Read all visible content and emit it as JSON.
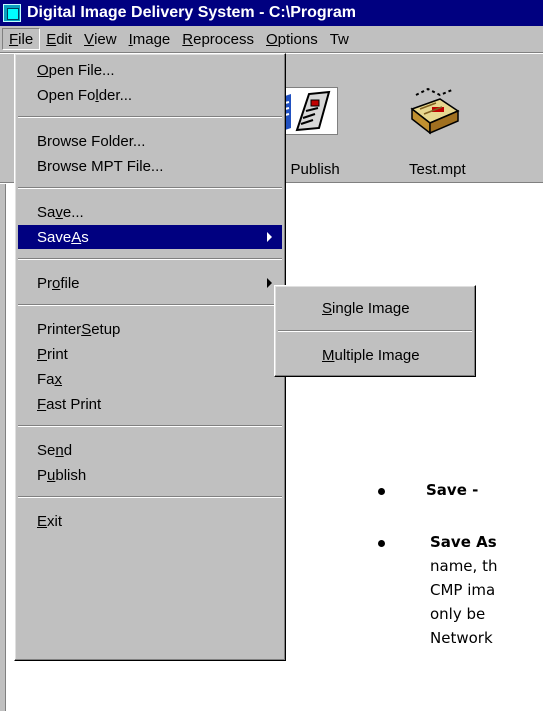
{
  "window": {
    "title": "Digital Image Delivery System - C:\\Program"
  },
  "menubar": {
    "items": [
      {
        "key": "file",
        "pre": "",
        "u": "F",
        "post": "ile"
      },
      {
        "key": "edit",
        "pre": "",
        "u": "E",
        "post": "dit"
      },
      {
        "key": "view",
        "pre": "",
        "u": "V",
        "post": "iew"
      },
      {
        "key": "image",
        "pre": "",
        "u": "I",
        "post": "mage"
      },
      {
        "key": "reprocess",
        "pre": "",
        "u": "R",
        "post": "eprocess"
      },
      {
        "key": "options",
        "pre": "",
        "u": "O",
        "post": "ptions"
      },
      {
        "key": "tw",
        "pre": "Tw",
        "u": "",
        "post": ""
      }
    ]
  },
  "toolbar": {
    "buttons": [
      {
        "label": "d Publish"
      },
      {
        "label": "Test.mpt"
      }
    ]
  },
  "file_menu": {
    "items": [
      {
        "key": "open-file",
        "pre": "",
        "u": "O",
        "post": "pen File..."
      },
      {
        "key": "open-folder",
        "pre": "Open Fo",
        "u": "l",
        "post": "der..."
      },
      {
        "key": "browse-folder",
        "pre": "Browse Folder...",
        "u": "",
        "post": ""
      },
      {
        "key": "browse-mpt-file",
        "pre": "Browse MPT File...",
        "u": "",
        "post": ""
      },
      {
        "key": "save",
        "pre": "Sa",
        "u": "v",
        "post": "e..."
      },
      {
        "key": "save-as",
        "pre": "Save ",
        "u": "A",
        "post": "s"
      },
      {
        "key": "profile",
        "pre": "Pr",
        "u": "o",
        "post": "file"
      },
      {
        "key": "printer-setup",
        "pre": "Printer ",
        "u": "S",
        "post": "etup"
      },
      {
        "key": "print",
        "pre": "",
        "u": "P",
        "post": "rint"
      },
      {
        "key": "fax",
        "pre": "Fa",
        "u": "x",
        "post": ""
      },
      {
        "key": "fast-print",
        "pre": "",
        "u": "F",
        "post": "ast Print"
      },
      {
        "key": "send",
        "pre": "Se",
        "u": "n",
        "post": "d"
      },
      {
        "key": "publish",
        "pre": "P",
        "u": "u",
        "post": "blish"
      },
      {
        "key": "exit",
        "pre": "",
        "u": "E",
        "post": "xit"
      }
    ]
  },
  "save_as_submenu": {
    "items": [
      {
        "key": "single-image",
        "pre": "",
        "u": "S",
        "post": "ingle Image"
      },
      {
        "key": "multiple-image",
        "pre": "",
        "u": "M",
        "post": "ultiple Image"
      }
    ]
  },
  "help_text": {
    "bullet1": "Save -",
    "bullet2": "Save As",
    "lines": [
      "name, th",
      "CMP ima",
      "only be",
      "Network"
    ]
  }
}
